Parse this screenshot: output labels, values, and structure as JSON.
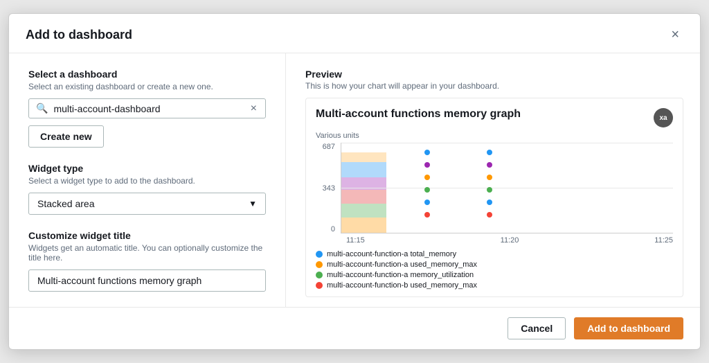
{
  "modal": {
    "title": "Add to dashboard",
    "close_label": "×"
  },
  "left": {
    "select_dashboard": {
      "label": "Select a dashboard",
      "desc": "Select an existing dashboard or create a new one.",
      "search_placeholder": "multi-account-dashboard",
      "search_value": "multi-account-dashboard",
      "clear_label": "×",
      "create_new_label": "Create new"
    },
    "widget_type": {
      "label": "Widget type",
      "desc": "Select a widget type to add to the dashboard.",
      "value": "Stacked area"
    },
    "customize": {
      "label": "Customize widget title",
      "desc": "Widgets get an automatic title. You can optionally customize the title here.",
      "input_value": "Multi-account functions memory graph"
    }
  },
  "right": {
    "preview_label": "Preview",
    "preview_desc": "This is how your chart will appear in your dashboard.",
    "chart": {
      "title": "Multi-account functions memory graph",
      "avatar": "xa",
      "units_label": "Various units",
      "y_labels": [
        "687",
        "343",
        "0"
      ],
      "x_labels": [
        "11:15",
        "11:20",
        "11:25"
      ],
      "legend": [
        {
          "color": "#2196f3",
          "text": "multi-account-function-a total_memory"
        },
        {
          "color": "#ff9800",
          "text": "multi-account-function-a used_memory_max"
        },
        {
          "color": "#4caf50",
          "text": "multi-account-function-a memory_utilization"
        },
        {
          "color": "#f44336",
          "text": "multi-account-function-b used_memory_max"
        }
      ]
    }
  },
  "footer": {
    "cancel_label": "Cancel",
    "add_label": "Add to dashboard"
  }
}
